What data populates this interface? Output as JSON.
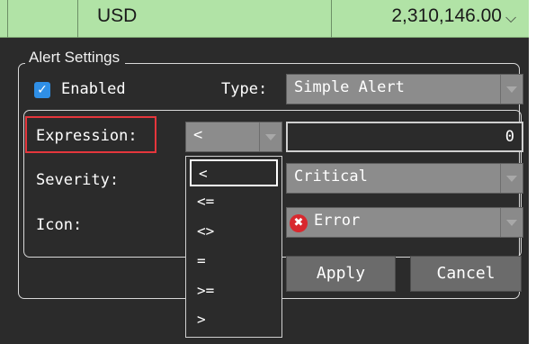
{
  "grid_row": {
    "currency": "USD",
    "amount": "2,310,146.00",
    "chevron": "⌵"
  },
  "alert_settings": {
    "title": "Alert Settings",
    "enabled_label": "Enabled",
    "enabled_checked": true,
    "type_label": "Type:",
    "type_value": "Simple Alert",
    "expression_label": "Expression:",
    "operator_value": "<",
    "expression_value": "0",
    "severity_label": "Severity:",
    "severity_value": "Critical",
    "icon_label": "Icon:",
    "icon_value": "Error",
    "icon_name": "error-icon",
    "apply_label": "Apply",
    "cancel_label": "Cancel"
  },
  "operator_options": [
    "<",
    "<=",
    "<>",
    "=",
    ">=",
    ">"
  ],
  "colors": {
    "grid_row_bg": "#b1e3a6",
    "panel_bg": "#2b2b2b",
    "highlight_frame": "#e5363c",
    "checkbox_accent": "#2f8fe6"
  }
}
